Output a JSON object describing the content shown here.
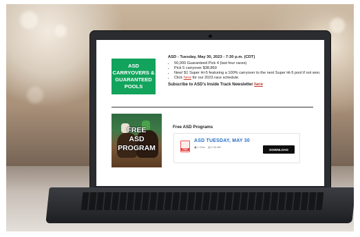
{
  "promo": {
    "lines": [
      "ASD",
      "CARRYOVERS &",
      "GUARANTEED",
      "POOLS"
    ],
    "bg_color": "#12a35c"
  },
  "news": {
    "heading": "ASD - Tuesday, May 30, 2023 - 7:30 p.m. (CDT)",
    "items": [
      "50,000 Guaranteed Pick 4 (last four races)",
      "Pick 5 carryover $38,869",
      "New! $1 Super Hi-5 featuring a 100% carryover to the next Super Hi-5 pool if not won."
    ],
    "schedule_prefix": "Click ",
    "schedule_link": "here",
    "schedule_suffix": " for our 2023 race schedule.",
    "subscribe_text": "Subscribe to ASD's Inside Track Newsletter ",
    "subscribe_link": "here"
  },
  "thumbnail": {
    "lines": [
      "FREE",
      "ASD",
      "PROGRAM"
    ]
  },
  "programs": {
    "title": "Free ASD Programs",
    "card_title": "ASD TUESDAY, MAY 30",
    "file_icon": "pdf-icon",
    "file_label": "PDF",
    "meta_pages": "1 Files",
    "meta_size": "2.45 MB",
    "download_label": "DOWNLOAD"
  }
}
